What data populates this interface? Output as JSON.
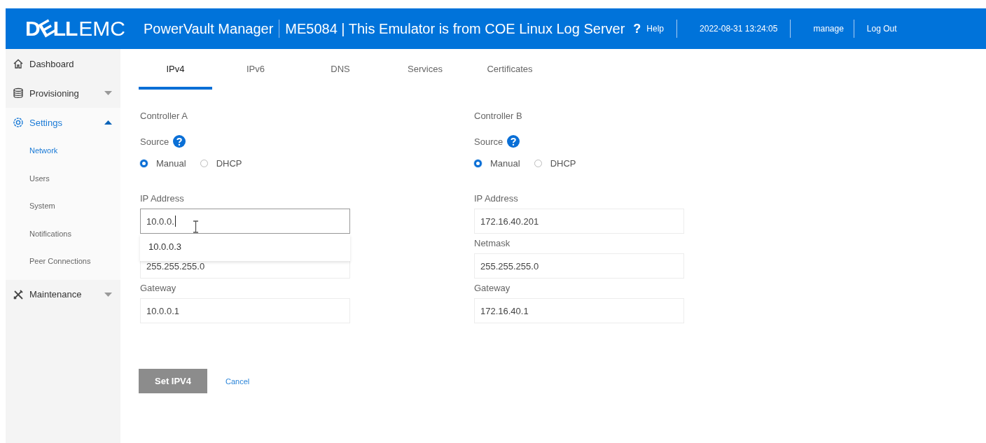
{
  "header": {
    "logo": {
      "brand": "DELL",
      "sub": "EMC"
    },
    "title": "PowerVault Manager",
    "system": "ME5084 | This Emulator is from COE Linux Log Server",
    "help_glyph": "?",
    "help": "Help",
    "datetime": "2022-08-31 13:24:05",
    "user": "manage",
    "logout": "Log Out"
  },
  "sidebar": {
    "items": [
      {
        "label": "Dashboard",
        "selected": false
      },
      {
        "label": "Provisioning",
        "expanded": false,
        "selected": false
      },
      {
        "label": "Settings",
        "expanded": true,
        "selected": true,
        "children": [
          {
            "label": "Network",
            "selected": true
          },
          {
            "label": "Users",
            "selected": false
          },
          {
            "label": "System",
            "selected": false
          },
          {
            "label": "Notifications",
            "selected": false
          },
          {
            "label": "Peer Connections",
            "selected": false
          }
        ]
      },
      {
        "label": "Maintenance",
        "expanded": false,
        "selected": false
      }
    ]
  },
  "tabs": [
    {
      "label": "IPv4",
      "selected": true
    },
    {
      "label": "IPv6",
      "selected": false
    },
    {
      "label": "DNS",
      "selected": false
    },
    {
      "label": "Services",
      "selected": false
    },
    {
      "label": "Certificates",
      "selected": false
    }
  ],
  "controllers": [
    {
      "title": "Controller A",
      "source_label": "Source",
      "options": [
        {
          "label": "Manual",
          "selected": true
        },
        {
          "label": "DHCP",
          "selected": false
        }
      ],
      "fields": [
        {
          "label": "IP Address",
          "value": "10.0.0.",
          "focused": true,
          "suggestions": [
            "10.0.0.3"
          ]
        },
        {
          "value": "255.255.255.0",
          "focused": false
        },
        {
          "label": "Gateway",
          "value": "10.0.0.1",
          "focused": false
        }
      ]
    },
    {
      "title": "Controller B",
      "source_label": "Source",
      "options": [
        {
          "label": "Manual",
          "selected": true
        },
        {
          "label": "DHCP",
          "selected": false
        }
      ],
      "fields": [
        {
          "label": "IP Address",
          "value": "172.16.40.201",
          "focused": false
        },
        {
          "label": "Netmask",
          "value": "255.255.255.0",
          "focused": false
        },
        {
          "label": "Gateway",
          "value": "172.16.40.1",
          "focused": false
        }
      ]
    }
  ],
  "actions": {
    "submit": "Set IPV4",
    "cancel": "Cancel"
  }
}
